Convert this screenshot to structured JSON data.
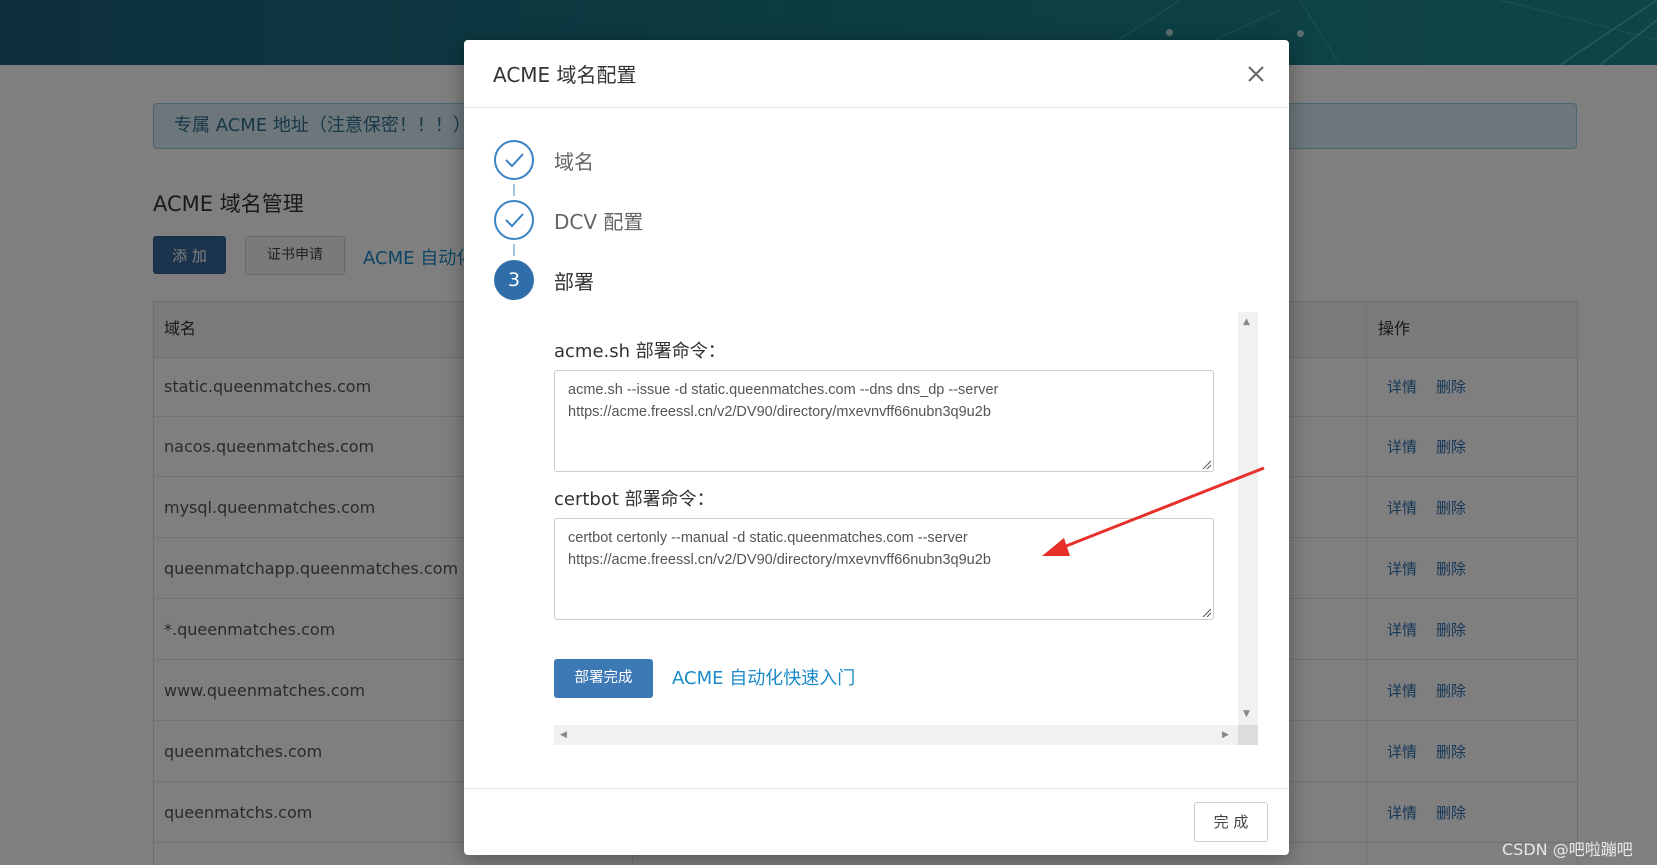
{
  "background": {
    "notice": "专属 ACME 地址（注意保密！！！）",
    "section_title": "ACME 域名管理",
    "add_button": "添 加",
    "cert_button": "证书申请",
    "acme_link": "ACME 自动化",
    "columns": [
      "域名",
      "操作"
    ],
    "rows": [
      "static.queenmatches.com",
      "nacos.queenmatches.com",
      "mysql.queenmatches.com",
      "queenmatchapp.queenmatches.com",
      "*.queenmatches.com",
      "www.queenmatches.com",
      "queenmatches.com",
      "queenmatchs.com"
    ],
    "row_actions": {
      "details": "详情",
      "delete": "删除"
    }
  },
  "modal": {
    "title": "ACME 域名配置",
    "close_icon": "close-icon",
    "steps": [
      {
        "label": "域名",
        "status": "done"
      },
      {
        "label": "DCV 配置",
        "status": "done"
      },
      {
        "number": "3",
        "label": "部署",
        "status": "active"
      }
    ],
    "acme_sh": {
      "label": "acme.sh 部署命令：",
      "lines": [
        "acme.sh --issue -d static.queenmatches.com  --dns dns_dp --server",
        "https://acme.freessl.cn/v2/DV90/directory/mxevnvff66nubn3q9u2b"
      ]
    },
    "certbot": {
      "label": "certbot 部署命令：",
      "lines": [
        "certbot certonly --manual -d static.queenmatches.com  --server",
        "https://acme.freessl.cn/v2/DV90/directory/mxevnvff66nubn3q9u2b"
      ]
    },
    "deploy_done_button": "部署完成",
    "quick_start_link": "ACME 自动化快速入门",
    "finish_button": "完 成"
  },
  "annotation_arrow_color": "#e8302a",
  "watermark": "CSDN @吧啦蹦吧"
}
